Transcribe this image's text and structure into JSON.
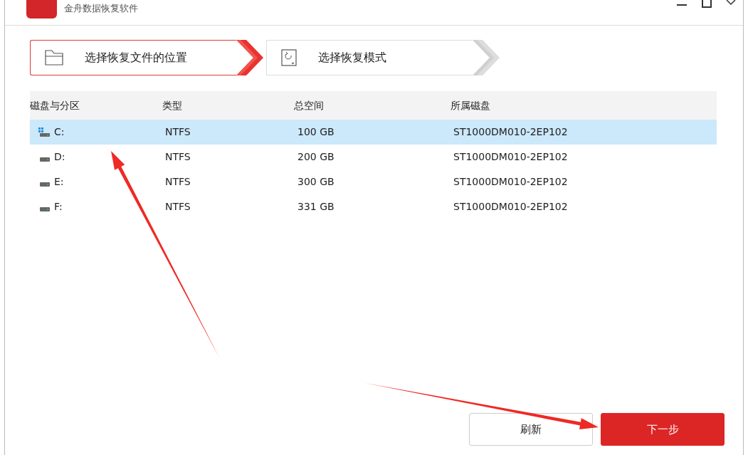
{
  "window": {
    "title": "金舟数据恢复软件"
  },
  "steps": [
    {
      "label": "选择恢复文件的位置",
      "selected": true,
      "kind": "folder"
    },
    {
      "label": "选择恢复模式",
      "selected": false,
      "kind": "disk"
    }
  ],
  "table": {
    "columns": [
      "磁盘与分区",
      "类型",
      "总空间",
      "所属磁盘"
    ],
    "rows": [
      {
        "drive": "C:",
        "kind": "system",
        "type": "NTFS",
        "size": "100 GB",
        "disk": "ST1000DM010-2EP102",
        "selected": true
      },
      {
        "drive": "D:",
        "kind": "disk",
        "type": "NTFS",
        "size": "200 GB",
        "disk": "ST1000DM010-2EP102",
        "selected": false
      },
      {
        "drive": "E:",
        "kind": "disk",
        "type": "NTFS",
        "size": "300 GB",
        "disk": "ST1000DM010-2EP102",
        "selected": false
      },
      {
        "drive": "F:",
        "kind": "disk",
        "type": "NTFS",
        "size": "331 GB",
        "disk": "ST1000DM010-2EP102",
        "selected": false
      }
    ]
  },
  "buttons": [
    {
      "label": "刷新",
      "kind": "secondary"
    },
    {
      "label": "下一步",
      "kind": "primary"
    }
  ],
  "annotations": [
    {
      "kind": "arrow"
    },
    {
      "kind": "arrow"
    }
  ]
}
